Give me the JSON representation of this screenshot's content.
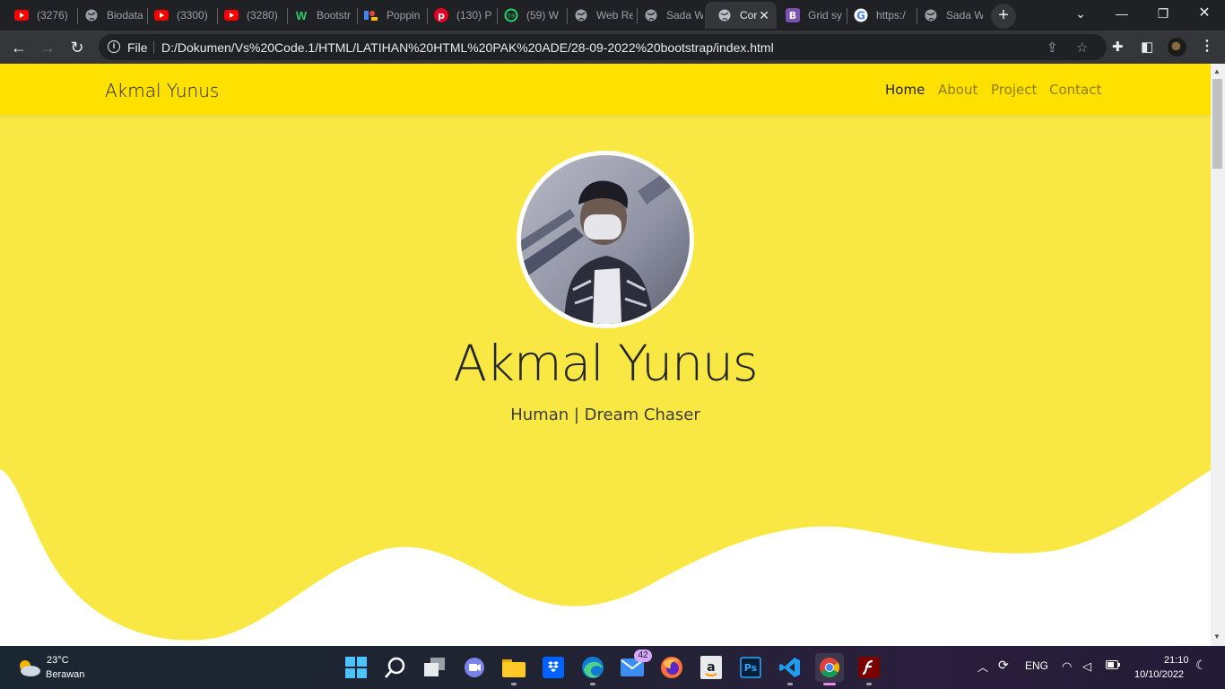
{
  "browser": {
    "tabs": [
      {
        "title": "(3276)",
        "icon": "youtube-icon"
      },
      {
        "title": "Biodata",
        "icon": "globe-icon"
      },
      {
        "title": "(3300)",
        "icon": "youtube-icon"
      },
      {
        "title": "(3280)",
        "icon": "youtube-icon"
      },
      {
        "title": "Bootstr",
        "icon": "w-icon"
      },
      {
        "title": "Poppin",
        "icon": "google-fonts-icon"
      },
      {
        "title": "(130) P",
        "icon": "pinterest-icon"
      },
      {
        "title": "(59) W",
        "icon": "whatsapp-icon",
        "badge": "59"
      },
      {
        "title": "Web Re",
        "icon": "globe-icon"
      },
      {
        "title": "Sada W",
        "icon": "globe-icon"
      },
      {
        "title": "Cor",
        "icon": "globe-icon",
        "active": true
      },
      {
        "title": "Grid sy",
        "icon": "bootstrap-icon"
      },
      {
        "title": "https:/",
        "icon": "google-icon"
      },
      {
        "title": "Sada W",
        "icon": "globe-icon"
      }
    ],
    "new_tab_label": "+",
    "file_label": "File",
    "url": "D:/Dokumen/Vs%20Code.1/HTML/LATIHAN%20HTML%20PAK%20ADE/28-09-2022%20bootstrap/index.html"
  },
  "site": {
    "brand": "Akmal Yunus",
    "nav": [
      {
        "label": "Home",
        "active": true
      },
      {
        "label": "About",
        "active": false
      },
      {
        "label": "Project",
        "active": false
      },
      {
        "label": "Contact",
        "active": false
      }
    ],
    "hero": {
      "name": "Akmal Yunus",
      "subtitle": "Human | Dream Chaser"
    },
    "colors": {
      "navbar": "#ffe100",
      "hero": "#f9e843"
    }
  },
  "taskbar": {
    "weather": {
      "temp": "23°C",
      "desc": "Berawan"
    },
    "apps": [
      "start-icon",
      "search-icon",
      "task-view-icon",
      "teams-icon",
      "file-explorer-icon",
      "dropbox-icon",
      "edge-icon",
      "mail-icon",
      "firefox-icon",
      "amazon-icon",
      "photoshop-icon",
      "vscode-icon",
      "chrome-icon",
      "flash-icon"
    ],
    "mail_badge": "42",
    "tray": {
      "language": "ENG"
    },
    "clock": {
      "time": "21:10",
      "date": "10/10/2022"
    }
  }
}
